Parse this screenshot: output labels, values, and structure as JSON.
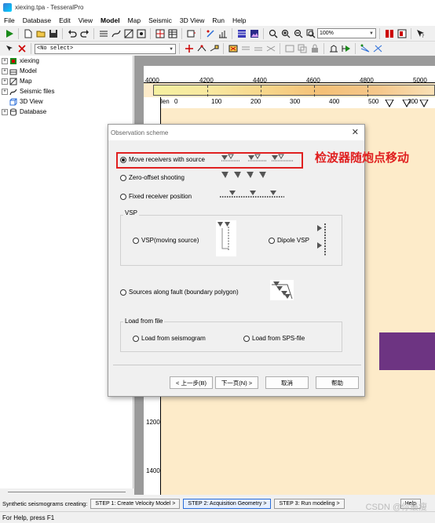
{
  "window": {
    "title": "xiexing.tpa - TesseralPro"
  },
  "menu": [
    "File",
    "Database",
    "Edit",
    "View",
    "Model",
    "Map",
    "Seismic",
    "3D View",
    "Run",
    "Help"
  ],
  "toolbar": {
    "zoom_value": "100%",
    "select_value": "<No select>"
  },
  "tree": {
    "items": [
      {
        "label": "xiexing",
        "icon": "project-icon",
        "expandable": true
      },
      {
        "label": "Model",
        "icon": "model-icon",
        "expandable": true
      },
      {
        "label": "Map",
        "icon": "map-icon",
        "expandable": true
      },
      {
        "label": "Seismic files",
        "icon": "seismic-icon",
        "expandable": true
      },
      {
        "label": "3D View",
        "icon": "3dview-icon",
        "expandable": false
      },
      {
        "label": "Database",
        "icon": "database-icon",
        "expandable": true
      }
    ]
  },
  "canvas": {
    "x_ruler": [
      "4000",
      "4200",
      "4400",
      "4600",
      "4800",
      "5000"
    ],
    "distance_ruler": [
      "len",
      "0",
      "100",
      "200",
      "300",
      "400",
      "500",
      "600"
    ],
    "depth_ruler": [
      "1200",
      "1400"
    ]
  },
  "dialog": {
    "title": "Observation scheme",
    "options": {
      "move_receivers": "Move receivers with source",
      "zero_offset": "Zero-offset shooting",
      "fixed_receiver": "Fixed receiver position",
      "vsp_moving": "VSP(moving source)",
      "dipole_vsp": "Dipole VSP",
      "sources_fault": "Sources along fault (boundary polygon)",
      "load_seismogram": "Load from seismogram",
      "load_sps": "Load from SPS-file"
    },
    "groups": {
      "vsp": "VSP",
      "load": "Load from file"
    },
    "buttons": {
      "back": "< 上一步(B)",
      "next": "下一页(N) >",
      "cancel": "取消",
      "help": "帮助"
    },
    "annotation": "检波器随炮点移动"
  },
  "steps": {
    "label": "Synthetic seismograms creating:",
    "items": [
      "STEP 1: Create Velocity Model >",
      "STEP 2: Acquisition Geometry >",
      "STEP 3: Run modeling >"
    ],
    "help": "Help"
  },
  "status": {
    "text": "For Help, press F1"
  },
  "watermark": "CSDN @你最瘦"
}
